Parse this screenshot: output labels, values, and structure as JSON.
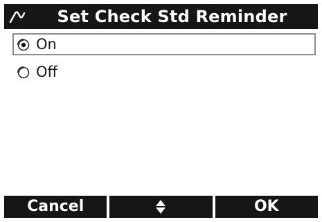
{
  "header": {
    "icon": "check-standard-icon",
    "title": "Set Check Std Reminder"
  },
  "options": [
    {
      "label": "On",
      "selected": true
    },
    {
      "label": "Off",
      "selected": false
    }
  ],
  "softkeys": {
    "left_label": "Cancel",
    "center_icon": "up-down-arrows-icon",
    "right_label": "OK"
  },
  "colors": {
    "bar": "#161616",
    "text_on_bar": "#ffffff",
    "selection_border": "#8c8c8c"
  }
}
